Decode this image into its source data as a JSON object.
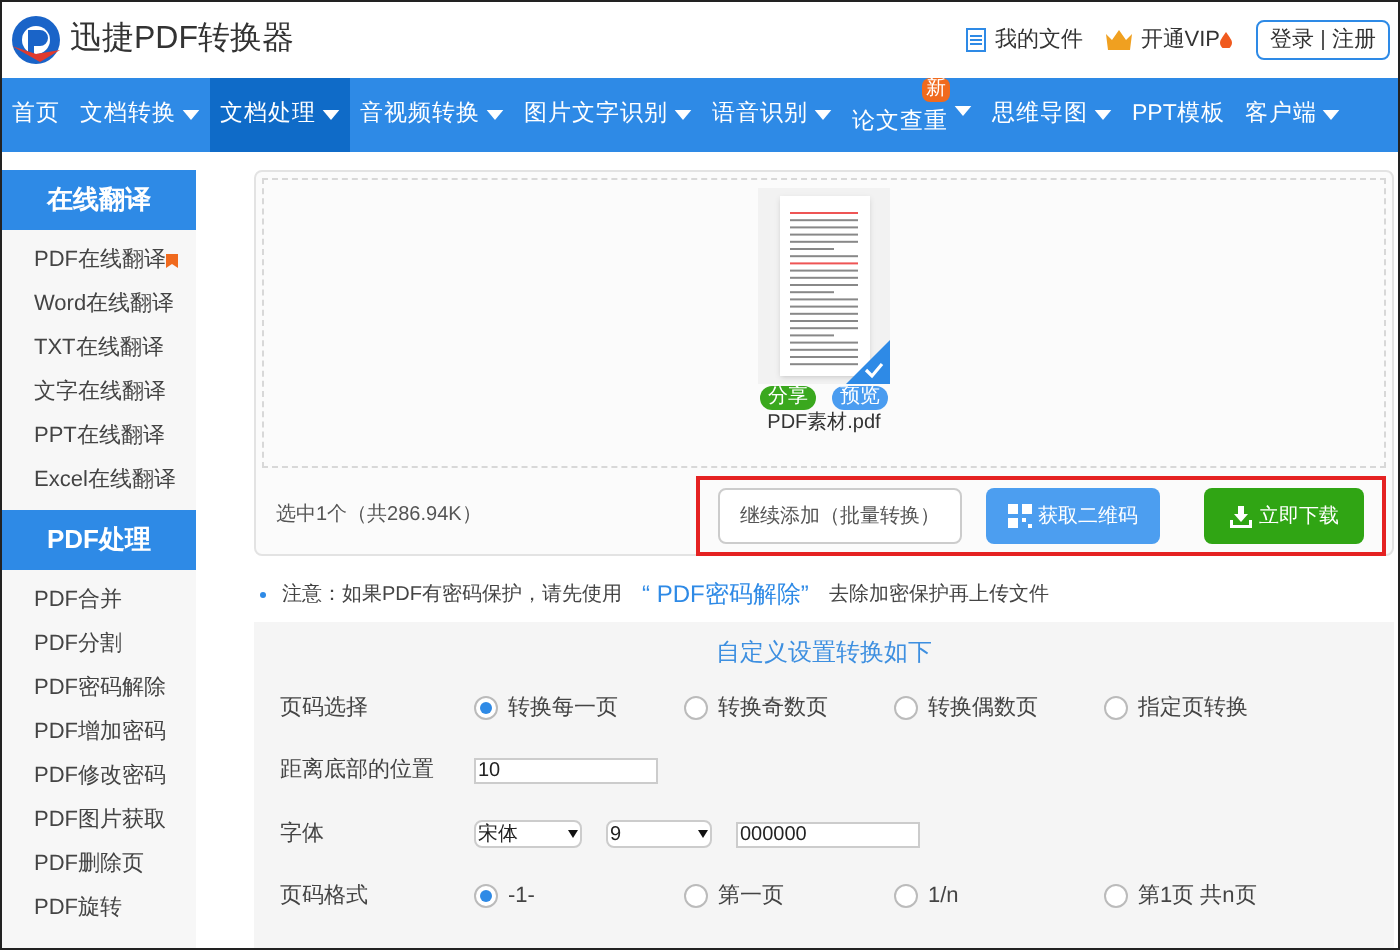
{
  "header": {
    "logo_text": "迅捷PDF转换器",
    "links": [
      {
        "text": "我的文件",
        "kind": "file"
      },
      {
        "text": "开通VIP",
        "kind": "vip"
      }
    ],
    "auth": [
      "登录",
      "注册"
    ]
  },
  "nav": [
    {
      "label": "首页",
      "dropdown": false,
      "selected": false
    },
    {
      "label": "文档转换",
      "dropdown": true,
      "selected": false
    },
    {
      "label": "文档处理",
      "dropdown": true,
      "selected": true
    },
    {
      "label": "音视频转换",
      "dropdown": true,
      "selected": false
    },
    {
      "label": "图片文字识别",
      "dropdown": true,
      "selected": false
    },
    {
      "label": "语音识别",
      "dropdown": true,
      "selected": false
    },
    {
      "label": "论文查重",
      "dropdown": true,
      "selected": false,
      "badge": "新"
    },
    {
      "label": "思维导图",
      "dropdown": true,
      "selected": false
    },
    {
      "label": "PPT模板",
      "dropdown": false,
      "selected": false
    },
    {
      "label": "客户端",
      "dropdown": true,
      "selected": false
    }
  ],
  "sidebar": [
    {
      "title": "在线翻译",
      "items": [
        {
          "label": "PDF在线翻译",
          "hot": true
        },
        {
          "label": "Word在线翻译",
          "hot": false
        },
        {
          "label": "TXT在线翻译",
          "hot": false
        },
        {
          "label": "文字在线翻译",
          "hot": false
        },
        {
          "label": "PPT在线翻译",
          "hot": false
        },
        {
          "label": "Excel在线翻译",
          "hot": false
        }
      ]
    },
    {
      "title": "PDF处理",
      "items": [
        {
          "label": "PDF合并",
          "hot": false
        },
        {
          "label": "PDF分割",
          "hot": false
        },
        {
          "label": "PDF密码解除",
          "hot": false
        },
        {
          "label": "PDF增加密码",
          "hot": false
        },
        {
          "label": "PDF修改密码",
          "hot": false
        },
        {
          "label": "PDF图片获取",
          "hot": false
        },
        {
          "label": "PDF删除页",
          "hot": false
        },
        {
          "label": "PDF旋转",
          "hot": false
        }
      ]
    }
  ],
  "upload": {
    "file": {
      "name": "PDF素材.pdf",
      "share": "分享",
      "preview": "预览",
      "selected": true
    },
    "summary": "选中1个（共286.94K）",
    "buttons": [
      {
        "label": "继续添加（批量转换）",
        "kind": "outline"
      },
      {
        "label": "获取二维码",
        "kind": "qr"
      },
      {
        "label": "立即下载",
        "kind": "download"
      }
    ]
  },
  "notice": {
    "prefix": "注意：如果PDF有密码保护，请先使用",
    "link": "“ PDF密码解除”",
    "suffix": "去除加密保护再上传文件"
  },
  "settings": {
    "title": "自定义设置转换如下",
    "rows": [
      {
        "kind": "radio",
        "label": "页码选择",
        "options": [
          {
            "label": "转换每一页",
            "selected": true
          },
          {
            "label": "转换奇数页",
            "selected": false
          },
          {
            "label": "转换偶数页",
            "selected": false
          },
          {
            "label": "指定页转换",
            "selected": false
          }
        ]
      },
      {
        "kind": "input",
        "label": "距离底部的位置",
        "value": "10"
      },
      {
        "kind": "font",
        "label": "字体",
        "selects": [
          "宋体",
          "9"
        ],
        "value": "000000"
      },
      {
        "kind": "radio",
        "label": "页码格式",
        "options": [
          {
            "label": "-1-",
            "selected": true
          },
          {
            "label": "第一页",
            "selected": false
          },
          {
            "label": "1/n",
            "selected": false
          },
          {
            "label": "第1页 共n页",
            "selected": false
          }
        ]
      }
    ]
  }
}
